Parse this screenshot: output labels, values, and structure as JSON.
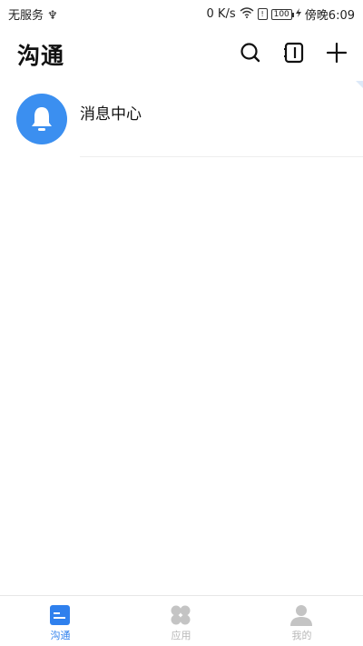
{
  "status_bar": {
    "carrier": "无服务 ♆",
    "speed": "0 K/s",
    "battery": "100",
    "time": "傍晚6:09"
  },
  "header": {
    "title": "沟通",
    "icons": [
      "search-icon",
      "contacts-icon",
      "plus-icon"
    ]
  },
  "messages": [
    {
      "title": "消息中心",
      "icon": "bell-icon",
      "avatar_color": "#3b8ff0"
    }
  ],
  "tabbar": {
    "tabs": [
      {
        "label": "沟通",
        "icon": "chat-icon",
        "active": true
      },
      {
        "label": "应用",
        "icon": "apps-icon",
        "active": false
      },
      {
        "label": "我的",
        "icon": "profile-icon",
        "active": false
      }
    ],
    "active_color": "#2f80ed",
    "inactive_color": "#c4c4c4"
  }
}
